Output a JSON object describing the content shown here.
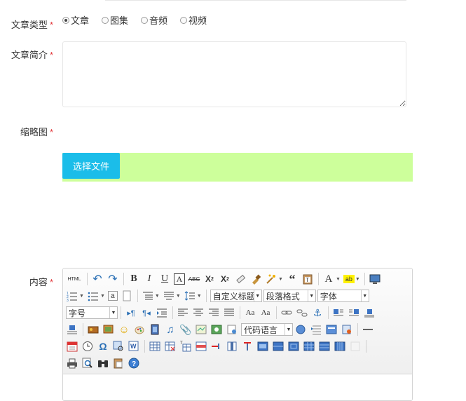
{
  "form": {
    "type_label": "文章类型",
    "required_mark": "*",
    "types": [
      {
        "label": "文章",
        "checked": true
      },
      {
        "label": "图集",
        "checked": false
      },
      {
        "label": "音频",
        "checked": false
      },
      {
        "label": "视频",
        "checked": false
      }
    ],
    "summary_label": "文章简介",
    "summary_value": "",
    "thumbnail_label": "缩略图",
    "upload_button": "选择文件",
    "content_label": "内容"
  },
  "editor": {
    "html_button": "HTML",
    "combos": {
      "custom_title": "自定义标题",
      "paragraph_format": "段落格式",
      "font_family": "字体",
      "font_size": "字号",
      "code_language": "代码语言"
    }
  },
  "colors": {
    "accent": "#1bbde9",
    "upload_bg": "#cdff9b",
    "required": "#e3393c"
  }
}
